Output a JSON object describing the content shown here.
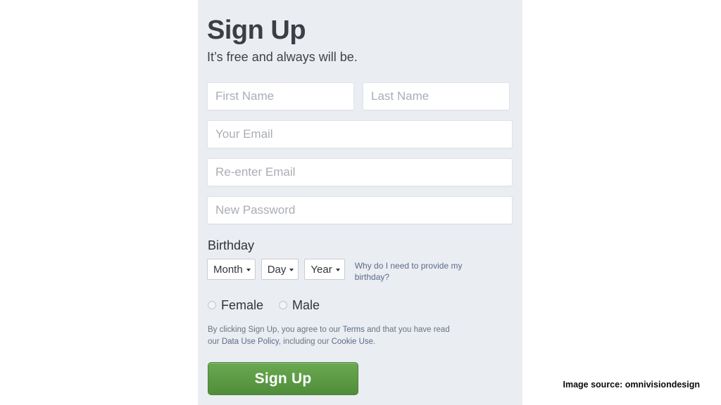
{
  "panel": {
    "heading": "Sign Up",
    "subheading": "It’s free and always will be.",
    "background_color": "#eaedf2"
  },
  "form": {
    "first_name": {
      "placeholder": "First Name",
      "value": ""
    },
    "last_name": {
      "placeholder": "Last Name",
      "value": ""
    },
    "email": {
      "placeholder": "Your Email",
      "value": ""
    },
    "reenter_email": {
      "placeholder": "Re-enter Email",
      "value": ""
    },
    "password": {
      "placeholder": "New Password",
      "value": ""
    },
    "birthday": {
      "label": "Birthday",
      "month_selected": "Month",
      "day_selected": "Day",
      "year_selected": "Year",
      "help_link": "Why do I need to provide my birthday?"
    },
    "gender": {
      "female_label": "Female",
      "male_label": "Male",
      "selected": ""
    },
    "legal": {
      "part1": "By clicking Sign Up, you agree to our ",
      "terms_link": "Terms",
      "part2": " and that you have read our ",
      "policy_link": "Data Use Policy",
      "part3": ", including our ",
      "cookie_link": "Cookie Use",
      "part4": "."
    },
    "submit_label": "Sign Up"
  },
  "attribution": {
    "text": "Image source: omnivisiondesign"
  },
  "colors": {
    "button_green": "#5d9c45",
    "link_blue": "#5b6b8a",
    "panel_bg": "#eaedf2"
  }
}
